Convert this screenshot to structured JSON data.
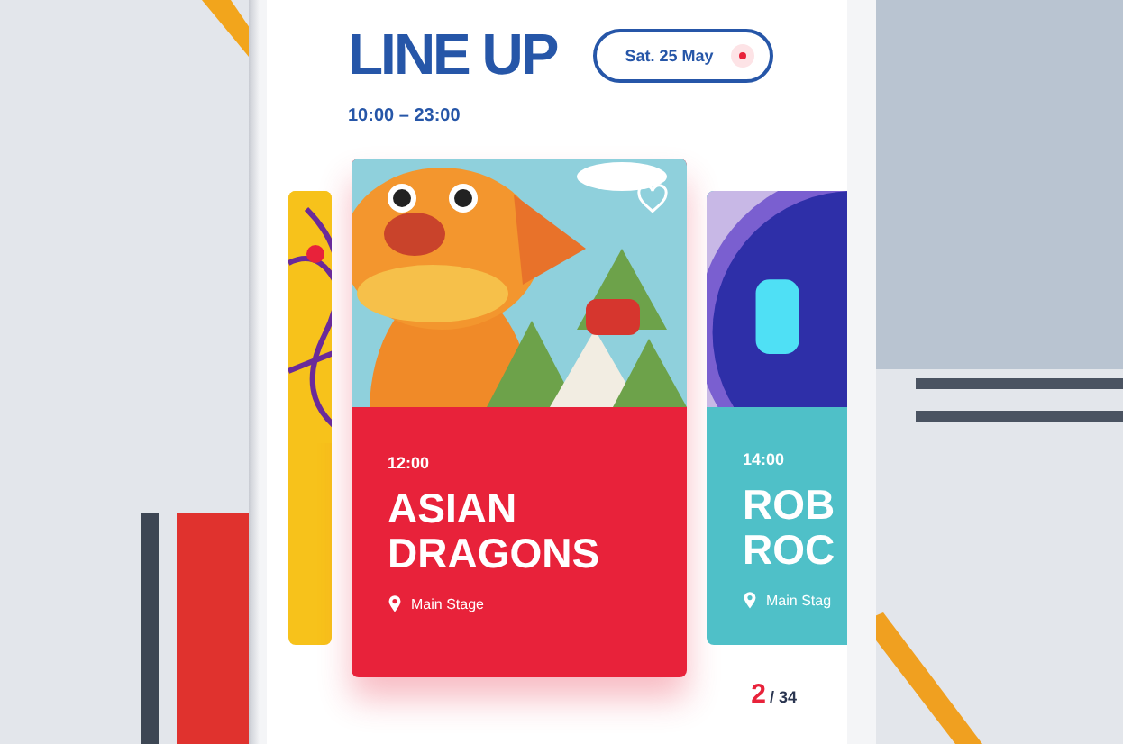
{
  "header": {
    "title": "LINE UP",
    "hours": "10:00 – 23:00",
    "date_button": "Sat. 25 May"
  },
  "cards": [
    {
      "kind": "side",
      "color": "#f7c21b"
    },
    {
      "kind": "main",
      "color": "#e8223a",
      "time": "12:00",
      "title_lines": [
        "ASIAN",
        "DRAGONS"
      ],
      "stage": "Main Stage",
      "liked": false
    },
    {
      "kind": "side",
      "color": "#4fc0c8",
      "time": "14:00",
      "title_lines": [
        "ROB",
        "ROC"
      ],
      "stage": "Main Stag"
    }
  ],
  "pagination": {
    "current": "2",
    "total": "/ 34"
  }
}
